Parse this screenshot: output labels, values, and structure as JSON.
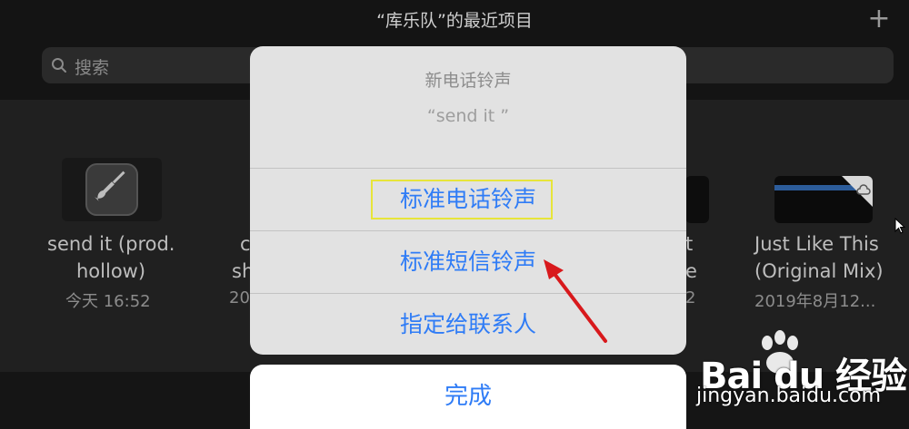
{
  "header": {
    "title": "“库乐队”的最近项目",
    "add_icon": "plus-icon"
  },
  "search": {
    "placeholder": "搜索",
    "icon": "search-icon"
  },
  "projects": [
    {
      "name_line1": "send it (prod.",
      "name_line2": "hollow)",
      "date": "今天 16:52",
      "icon": "guitar-icon"
    },
    {
      "name_line1": "c",
      "name_line2": "sh",
      "date": "20"
    },
    {
      "name_line1": "t",
      "name_line2": "e",
      "date": "2"
    },
    {
      "name_line1": "Just Like This",
      "name_line2": "(Original Mix)",
      "date": "2019年8月12...",
      "icon": "cloud-download-icon"
    }
  ],
  "sheet": {
    "title": "新电话铃声",
    "message": "“send it ”",
    "actions": [
      "标准电话铃声",
      "标准短信铃声",
      "指定给联系人"
    ],
    "done": "完成"
  },
  "watermark": {
    "brand": "Bai du 经验",
    "url": "jingyan.baidu.com"
  },
  "colors": {
    "accent": "#2f7cf6",
    "highlight": "#e7e53a",
    "arrow": "#d8191c"
  }
}
